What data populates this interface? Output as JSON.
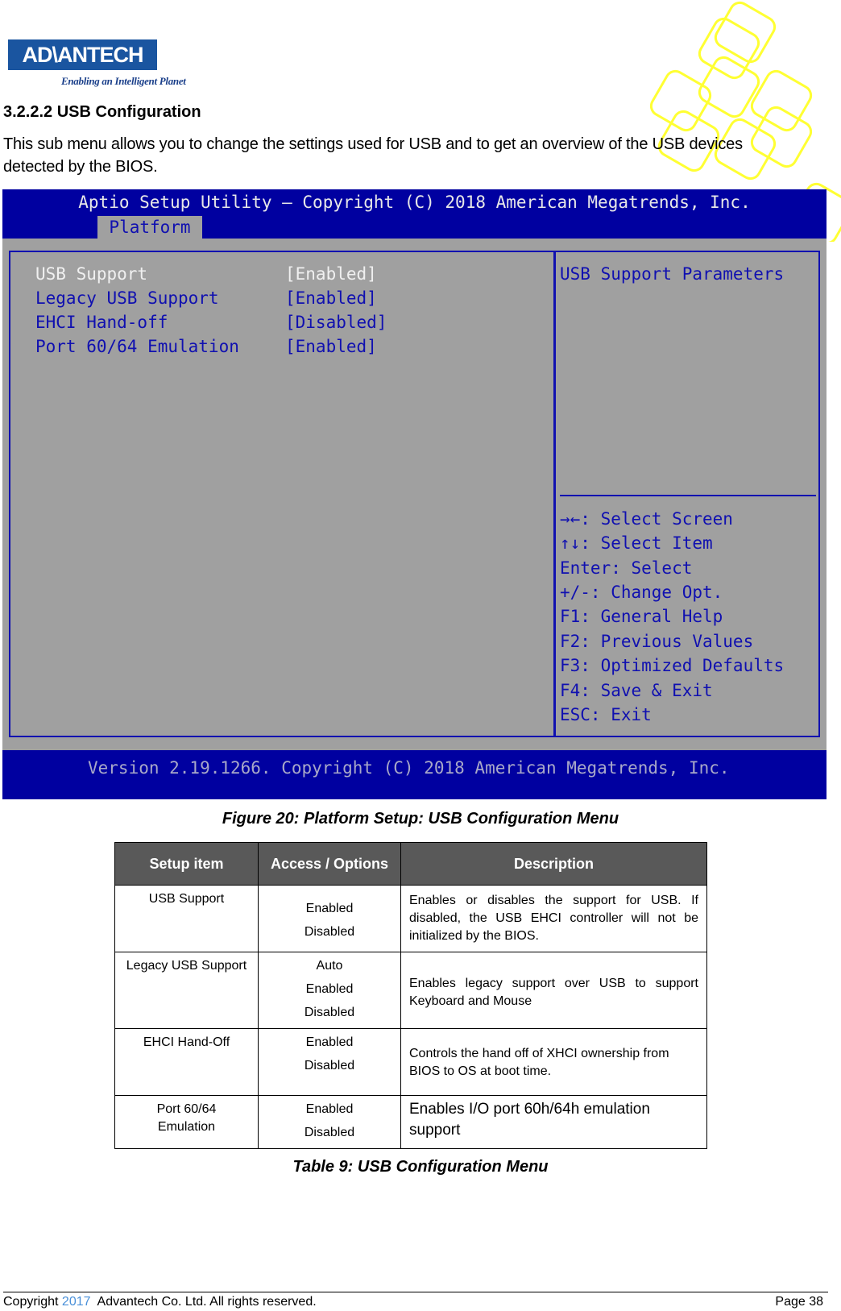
{
  "logo": {
    "brand": "ADVANTECH",
    "tagline": "Enabling an Intelligent Planet"
  },
  "heading": "3.2.2.2  USB Configuration",
  "intro": [
    "This sub menu allows you to change the settings used for USB and to get an overview of the USB devices",
    "detected by the BIOS."
  ],
  "bios": {
    "title": "Aptio Setup Utility – Copyright (C) 2018 American Megatrends, Inc.",
    "tab": "Platform",
    "items": [
      {
        "label": "USB Support",
        "value": "[Enabled]"
      },
      {
        "label": "Legacy USB Support",
        "value": "[Enabled]"
      },
      {
        "label": "EHCI Hand-off",
        "value": "[Disabled]"
      },
      {
        "label": "Port 60/64 Emulation",
        "value": "[Enabled]"
      }
    ],
    "help_title": "USB Support Parameters",
    "keys": [
      "→←: Select Screen",
      "↑↓: Select Item",
      "Enter: Select",
      "+/-: Change Opt.",
      "F1: General Help",
      "F2: Previous Values",
      "F3: Optimized Defaults",
      "F4: Save & Exit",
      "ESC: Exit"
    ],
    "version": "Version 2.19.1266. Copyright (C) 2018 American Megatrends, Inc.",
    "colors": {
      "blue": "#0000a0",
      "gray": "#a0a0a0",
      "text": "#1010b0"
    }
  },
  "figure_caption": "Figure 20: Platform Setup: USB Configuration Menu",
  "table": {
    "headers": [
      "Setup item",
      "Access / Options",
      "Description"
    ],
    "rows": [
      {
        "item": "USB Support",
        "options": [
          "Enabled",
          "Disabled"
        ],
        "description": "Enables or disables the support for USB. If disabled, the USB EHCI controller will not be initialized by the BIOS."
      },
      {
        "item": "Legacy USB Support",
        "options": [
          "Auto",
          "Enabled",
          "Disabled"
        ],
        "description": "Enables legacy support over USB to support Keyboard and Mouse"
      },
      {
        "item": "EHCI Hand-Off",
        "options": [
          "Enabled",
          "Disabled"
        ],
        "description": "Controls the hand off of XHCI ownership from BIOS to OS at boot time."
      },
      {
        "item": "Port 60/64 Emulation",
        "options": [
          "Enabled",
          "Disabled"
        ],
        "description": "Enables I/O port 60h/64h emulation support"
      }
    ]
  },
  "table_caption": "Table 9: USB Configuration Menu",
  "footer": {
    "copyright_prefix": "Copyright ",
    "year": "2017",
    "copyright_suffix": "  Advantech Co. Ltd. All rights reserved.",
    "page": "Page 38",
    "year_color": "#4a90d9"
  }
}
